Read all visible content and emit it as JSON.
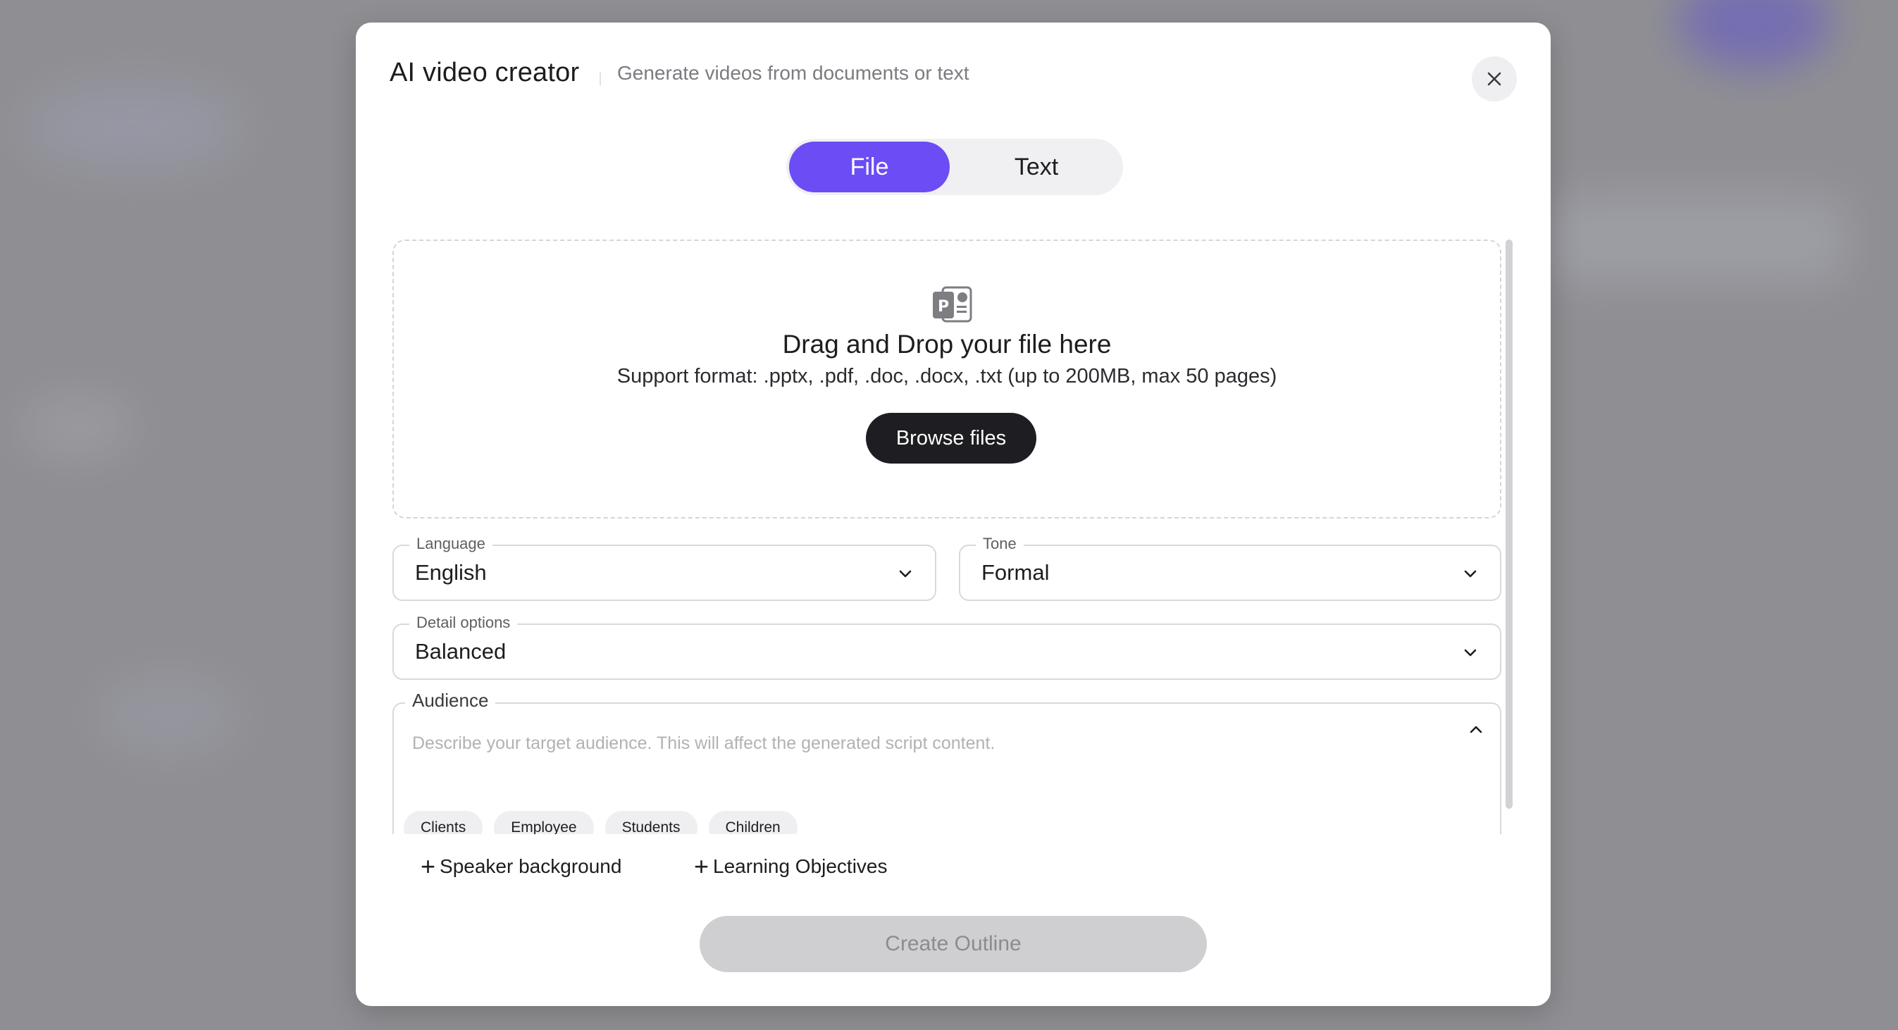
{
  "modal": {
    "title": "AI video creator",
    "subtitle": "Generate videos from documents or text",
    "close_icon": "close-icon"
  },
  "tabs": [
    {
      "label": "File",
      "active": true
    },
    {
      "label": "Text",
      "active": false
    }
  ],
  "dropzone": {
    "icon": "powerpoint-file-icon",
    "title": "Drag and Drop your file here",
    "support": "Support format: .pptx, .pdf, .doc, .docx, .txt (up to 200MB, max 50 pages)",
    "browse_label": "Browse files"
  },
  "fields": {
    "language": {
      "label": "Language",
      "value": "English"
    },
    "tone": {
      "label": "Tone",
      "value": "Formal"
    },
    "detail": {
      "label": "Detail options",
      "value": "Balanced"
    }
  },
  "audience": {
    "label": "Audience",
    "value": "",
    "placeholder": "Describe your target audience. This will affect the generated script content.",
    "chips": [
      "Clients",
      "Employee",
      "Students",
      "Children"
    ]
  },
  "extras": {
    "speaker": "Speaker background",
    "objectives": "Learning Objectives"
  },
  "create_button": {
    "label": "Create Outline",
    "disabled": true
  },
  "colors": {
    "accent": "#6c4cf5",
    "dark_button": "#1d1d22",
    "disabled_button": "#cfcfd1",
    "overlay": "#8f8f93"
  }
}
